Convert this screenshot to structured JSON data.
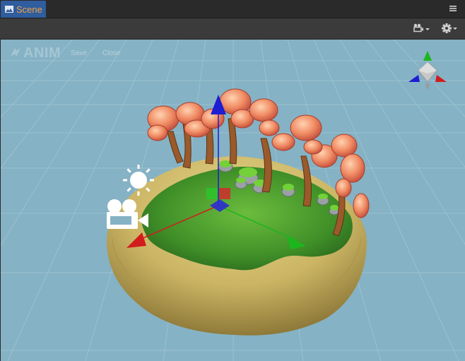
{
  "tab": {
    "label": "Scene"
  },
  "anim_toolbar": {
    "logo": "ANIM",
    "save_label": "Save",
    "close_label": "Close"
  },
  "colors": {
    "tab_active": "#2f5d9e",
    "tab_label": "#f3a545",
    "sky": "#85b2c4",
    "axis_x": "#d11d1d",
    "axis_y": "#1db51d",
    "axis_z": "#1d1dd1"
  },
  "icons": {
    "tab": "scene-icon",
    "menu": "hamburger-menu-icon",
    "camera": "camera-view-icon",
    "settings": "gear-icon",
    "light": "sun-light-icon",
    "scene_camera": "movie-camera-icon"
  }
}
